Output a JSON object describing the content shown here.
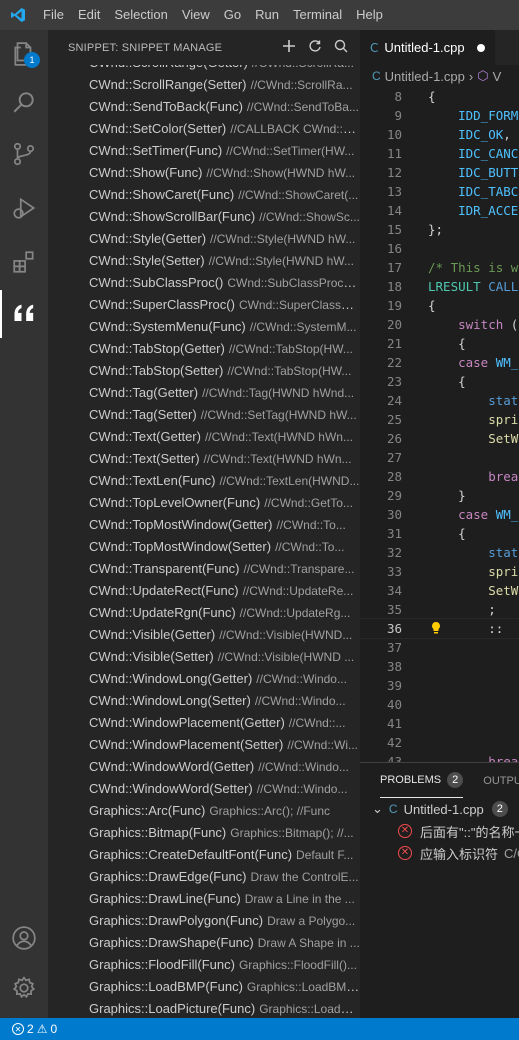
{
  "menu": [
    "File",
    "Edit",
    "Selection",
    "View",
    "Go",
    "Run",
    "Terminal",
    "Help"
  ],
  "activity": {
    "explorer_badge": "1",
    "accent": "#007acc"
  },
  "sidebar": {
    "title": "SNIPPET: SNIPPET MANAGE",
    "actions": [
      "add-icon",
      "refresh-icon",
      "search-icon"
    ],
    "items": [
      {
        "name": "CWnd::ScrollRange(Getter)",
        "desc": "//CWnd::ScrollRa..."
      },
      {
        "name": "CWnd::ScrollRange(Setter)",
        "desc": "//CWnd::ScrollRa..."
      },
      {
        "name": "CWnd::SendToBack(Func)",
        "desc": "//CWnd::SendToBa..."
      },
      {
        "name": "CWnd::SetColor(Setter)",
        "desc": "//CALLBACK CWnd::S..."
      },
      {
        "name": "CWnd::SetTimer(Func)",
        "desc": "//CWnd::SetTimer(HW..."
      },
      {
        "name": "CWnd::Show(Func)",
        "desc": "//CWnd::Show(HWND hW..."
      },
      {
        "name": "CWnd::ShowCaret(Func)",
        "desc": "//CWnd::ShowCaret(..."
      },
      {
        "name": "CWnd::ShowScrollBar(Func)",
        "desc": "//CWnd::ShowSc..."
      },
      {
        "name": "CWnd::Style(Getter)",
        "desc": "//CWnd::Style(HWND hW..."
      },
      {
        "name": "CWnd::Style(Setter)",
        "desc": "//CWnd::Style(HWND hW..."
      },
      {
        "name": "CWnd::SubClassProc()",
        "desc": "CWnd::SubClassProc(); ..."
      },
      {
        "name": "CWnd::SuperClassProc()",
        "desc": "CWnd::SuperClassPr..."
      },
      {
        "name": "CWnd::SystemMenu(Func)",
        "desc": "//CWnd::SystemM..."
      },
      {
        "name": "CWnd::TabStop(Getter)",
        "desc": "//CWnd::TabStop(HW..."
      },
      {
        "name": "CWnd::TabStop(Setter)",
        "desc": "//CWnd::TabStop(HW..."
      },
      {
        "name": "CWnd::Tag(Getter)",
        "desc": "//CWnd::Tag(HWND hWnd..."
      },
      {
        "name": "CWnd::Tag(Setter)",
        "desc": "//CWnd::SetTag(HWND hW..."
      },
      {
        "name": "CWnd::Text(Getter)",
        "desc": "//CWnd::Text(HWND hWn..."
      },
      {
        "name": "CWnd::Text(Setter)",
        "desc": "//CWnd::Text(HWND hWn..."
      },
      {
        "name": "CWnd::TextLen(Func)",
        "desc": "//CWnd::TextLen(HWND..."
      },
      {
        "name": "CWnd::TopLevelOwner(Func)",
        "desc": "//CWnd::GetTo..."
      },
      {
        "name": "CWnd::TopMostWindow(Getter)",
        "desc": "//CWnd::To..."
      },
      {
        "name": "CWnd::TopMostWindow(Setter)",
        "desc": "//CWnd::To..."
      },
      {
        "name": "CWnd::Transparent(Func)",
        "desc": "//CWnd::Transpare..."
      },
      {
        "name": "CWnd::UpdateRect(Func)",
        "desc": "//CWnd::UpdateRe..."
      },
      {
        "name": "CWnd::UpdateRgn(Func)",
        "desc": "//CWnd::UpdateRg..."
      },
      {
        "name": "CWnd::Visible(Getter)",
        "desc": "//CWnd::Visible(HWND..."
      },
      {
        "name": "CWnd::Visible(Setter)",
        "desc": "//CWnd::Visible(HWND ..."
      },
      {
        "name": "CWnd::WindowLong(Getter)",
        "desc": "//CWnd::Windo..."
      },
      {
        "name": "CWnd::WindowLong(Setter)",
        "desc": "//CWnd::Windo..."
      },
      {
        "name": "CWnd::WindowPlacement(Getter)",
        "desc": "//CWnd::..."
      },
      {
        "name": "CWnd::WindowPlacement(Setter)",
        "desc": "//CWnd::Wi..."
      },
      {
        "name": "CWnd::WindowWord(Getter)",
        "desc": "//CWnd::Windo..."
      },
      {
        "name": "CWnd::WindowWord(Setter)",
        "desc": "//CWnd::Windo..."
      },
      {
        "name": "Graphics::Arc(Func)",
        "desc": "Graphics::Arc();    //Func"
      },
      {
        "name": "Graphics::Bitmap(Func)",
        "desc": "Graphics::Bitmap(); //..."
      },
      {
        "name": "Graphics::CreateDefaultFont(Func)",
        "desc": "Default F..."
      },
      {
        "name": "Graphics::DrawEdge(Func)",
        "desc": "Draw the ControlE..."
      },
      {
        "name": "Graphics::DrawLine(Func)",
        "desc": "Draw a Line in the ..."
      },
      {
        "name": "Graphics::DrawPolygon(Func)",
        "desc": "Draw a Polygo..."
      },
      {
        "name": "Graphics::DrawShape(Func)",
        "desc": "Draw A Shape in ..."
      },
      {
        "name": "Graphics::FloodFill(Func)",
        "desc": "Graphics::FloodFill()..."
      },
      {
        "name": "Graphics::LoadBMP(Func)",
        "desc": "Graphics::LoadBMP..."
      },
      {
        "name": "Graphics::LoadPicture(Func)",
        "desc": "Graphics::LoadPi..."
      }
    ]
  },
  "editor": {
    "tab_label": "Untitled-1.cpp",
    "breadcrumb": [
      "Untitled-1.cpp",
      "V"
    ],
    "current_line": "36",
    "lines": [
      {
        "n": "8",
        "parts": [
          [
            "tx",
            "{"
          ]
        ]
      },
      {
        "n": "9",
        "parts": [
          [
            "mac",
            "    IDD_FORM"
          ]
        ]
      },
      {
        "n": "10",
        "parts": [
          [
            "mac",
            "    IDC_OK"
          ],
          [
            "tx",
            ","
          ]
        ]
      },
      {
        "n": "11",
        "parts": [
          [
            "mac",
            "    IDC_CANC"
          ]
        ]
      },
      {
        "n": "12",
        "parts": [
          [
            "mac",
            "    IDC_BUTT"
          ]
        ]
      },
      {
        "n": "13",
        "parts": [
          [
            "mac",
            "    IDC_TABC"
          ]
        ]
      },
      {
        "n": "14",
        "parts": [
          [
            "mac",
            "    IDR_ACCE"
          ]
        ]
      },
      {
        "n": "15",
        "parts": [
          [
            "tx",
            "};"
          ]
        ]
      },
      {
        "n": "16",
        "parts": []
      },
      {
        "n": "17",
        "parts": [
          [
            "cmt",
            "/* This is w"
          ]
        ]
      },
      {
        "n": "18",
        "parts": [
          [
            "ty",
            "LRESULT"
          ],
          [
            "tx",
            " "
          ],
          [
            "kw",
            "CALL"
          ]
        ]
      },
      {
        "n": "19",
        "parts": [
          [
            "tx",
            "{"
          ]
        ]
      },
      {
        "n": "20",
        "parts": [
          [
            "ctrl",
            "    switch"
          ],
          [
            "tx",
            " ("
          ]
        ]
      },
      {
        "n": "21",
        "parts": [
          [
            "tx",
            "    {"
          ]
        ]
      },
      {
        "n": "22",
        "parts": [
          [
            "ctrl",
            "    case"
          ],
          [
            "tx",
            " "
          ],
          [
            "mac",
            "WM_"
          ]
        ]
      },
      {
        "n": "23",
        "parts": [
          [
            "tx",
            "    {"
          ]
        ]
      },
      {
        "n": "24",
        "parts": [
          [
            "kw",
            "        stat"
          ]
        ]
      },
      {
        "n": "25",
        "parts": [
          [
            "fn",
            "        spri"
          ]
        ]
      },
      {
        "n": "26",
        "parts": [
          [
            "fn",
            "        SetW"
          ]
        ]
      },
      {
        "n": "27",
        "parts": []
      },
      {
        "n": "28",
        "parts": [
          [
            "ctrl",
            "        brea"
          ]
        ]
      },
      {
        "n": "29",
        "parts": [
          [
            "tx",
            "    }"
          ]
        ]
      },
      {
        "n": "30",
        "parts": [
          [
            "ctrl",
            "    case"
          ],
          [
            "tx",
            " "
          ],
          [
            "mac",
            "WM_"
          ]
        ]
      },
      {
        "n": "31",
        "parts": [
          [
            "tx",
            "    {"
          ]
        ]
      },
      {
        "n": "32",
        "parts": [
          [
            "kw",
            "        stat"
          ]
        ]
      },
      {
        "n": "33",
        "parts": [
          [
            "fn",
            "        spri"
          ]
        ]
      },
      {
        "n": "34",
        "parts": [
          [
            "fn",
            "        SetW"
          ]
        ]
      },
      {
        "n": "35",
        "parts": [
          [
            "tx",
            "        ;"
          ]
        ]
      },
      {
        "n": "36",
        "parts": [
          [
            "tx",
            "        ::"
          ]
        ]
      },
      {
        "n": "37",
        "parts": []
      },
      {
        "n": "38",
        "parts": []
      },
      {
        "n": "39",
        "parts": []
      },
      {
        "n": "40",
        "parts": []
      },
      {
        "n": "41",
        "parts": []
      },
      {
        "n": "42",
        "parts": []
      },
      {
        "n": "43",
        "parts": [
          [
            "ctrl",
            "        brea"
          ]
        ]
      }
    ]
  },
  "panel": {
    "tabs": [
      {
        "label": "PROBLEMS",
        "count": "2"
      },
      {
        "label": "OUTPUT"
      }
    ],
    "file": {
      "name": "Untitled-1.cpp",
      "count": "2"
    },
    "problems": [
      {
        "text": "后面有\"::\"的名称一"
      },
      {
        "text": "应输入标识符",
        "source": "C/C"
      }
    ]
  },
  "status": {
    "errors": "2",
    "warnings": "0",
    "color": "#007acc"
  }
}
